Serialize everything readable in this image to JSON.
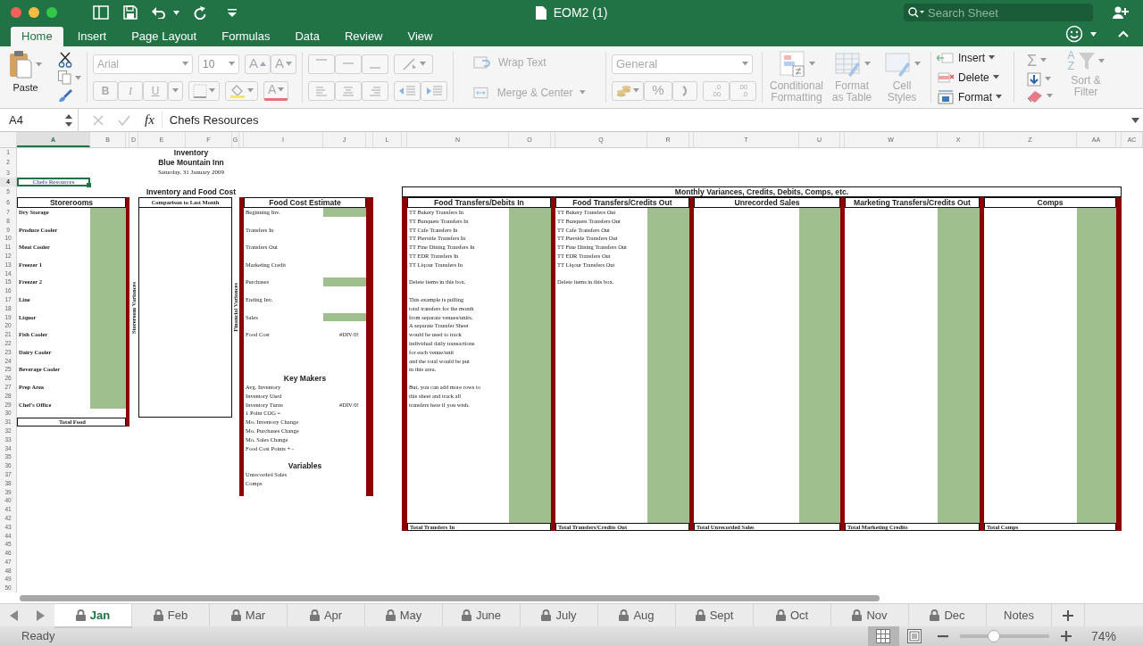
{
  "window": {
    "title": "EOM2 (1)"
  },
  "search": {
    "placeholder": "Search Sheet"
  },
  "ribbon_tabs": [
    {
      "label": "Home",
      "selected": true
    },
    {
      "label": "Insert",
      "selected": false
    },
    {
      "label": "Page Layout",
      "selected": false
    },
    {
      "label": "Formulas",
      "selected": false
    },
    {
      "label": "Data",
      "selected": false
    },
    {
      "label": "Review",
      "selected": false
    },
    {
      "label": "View",
      "selected": false
    }
  ],
  "ribbon": {
    "paste": {
      "label": "Paste",
      "disabled": false
    },
    "font": {
      "name": "Arial",
      "size": "10",
      "disabled": true
    },
    "font_buttons": [
      {
        "label": "A",
        "kind": "grow"
      },
      {
        "label": "A",
        "kind": "shrink"
      }
    ],
    "style_buttons": [
      {
        "label": "B",
        "kind": "bold"
      },
      {
        "label": "I",
        "kind": "italic"
      },
      {
        "label": "U",
        "kind": "underline"
      }
    ],
    "font_color": {
      "label": "A"
    },
    "wrap_text": {
      "label": "Wrap Text",
      "disabled": true
    },
    "merge": {
      "label": "Merge & Center",
      "disabled": true
    },
    "number_format": {
      "value": "General",
      "disabled": true
    },
    "percent": "%",
    "decimal_buttons": [
      {
        "top": ".0",
        "bottom": ".00"
      },
      {
        "top": ".00",
        "bottom": ".0"
      }
    ],
    "styles": [
      {
        "label": "Conditional Formatting",
        "kind": "conditional",
        "disabled": true
      },
      {
        "label": "Format as Table",
        "kind": "table",
        "disabled": true
      },
      {
        "label": "Cell Styles",
        "kind": "cell",
        "disabled": true
      }
    ],
    "cells": [
      {
        "label": "Insert",
        "kind": "insert",
        "disabled": false
      },
      {
        "label": "Delete",
        "kind": "delete",
        "disabled": false
      },
      {
        "label": "Format",
        "kind": "format",
        "disabled": false
      }
    ],
    "sum": "Σ",
    "sort": {
      "label": "Sort & Filter",
      "letters": [
        "A",
        "Z"
      ],
      "disabled": true
    }
  },
  "formula_bar": {
    "name_box": "A4",
    "function_label": "fx",
    "content": "Chefs Resources"
  },
  "sheet": {
    "columns": [
      {
        "label": "A",
        "selected": true
      },
      {
        "label": "B",
        "selected": false
      },
      {
        "selected": false
      },
      {
        "label": "D",
        "selected": false
      },
      {
        "label": "E",
        "selected": false
      },
      {
        "label": "F",
        "selected": false
      },
      {
        "label": "G",
        "selected": false
      },
      {
        "selected": false
      },
      {
        "label": "I",
        "selected": false
      },
      {
        "label": "J",
        "selected": false
      },
      {
        "selected": false
      },
      {
        "label": "L",
        "selected": false
      },
      {
        "selected": false
      },
      {
        "label": "N",
        "selected": false
      },
      {
        "label": "O",
        "selected": false
      },
      {
        "selected": false
      },
      {
        "label": "Q",
        "selected": false
      },
      {
        "label": "R",
        "selected": false
      },
      {
        "selected": false
      },
      {
        "label": "T",
        "selected": false
      },
      {
        "label": "U",
        "selected": false
      },
      {
        "selected": false
      },
      {
        "label": "W",
        "selected": false
      },
      {
        "label": "X",
        "selected": false
      },
      {
        "selected": false
      },
      {
        "label": "Z",
        "selected": false
      },
      {
        "label": "AA",
        "selected": false
      },
      {
        "selected": false
      },
      {
        "label": "AC",
        "selected": false
      }
    ],
    "rows": [
      {
        "label": "1",
        "selected": false
      },
      {
        "label": "2",
        "selected": false
      },
      {
        "label": "3",
        "selected": false
      },
      {
        "label": "4",
        "selected": true
      },
      {
        "label": "5",
        "selected": false
      },
      {
        "label": "6",
        "selected": false
      },
      {
        "label": "7",
        "selected": false
      },
      {
        "label": "8",
        "selected": false
      },
      {
        "label": "9",
        "selected": false
      },
      {
        "label": "10",
        "selected": false
      },
      {
        "label": "11",
        "selected": false
      },
      {
        "label": "12",
        "selected": false
      },
      {
        "label": "13",
        "selected": false
      },
      {
        "label": "14",
        "selected": false
      },
      {
        "label": "15",
        "selected": false
      },
      {
        "label": "16",
        "selected": false
      },
      {
        "label": "17",
        "selected": false
      },
      {
        "label": "18",
        "selected": false
      },
      {
        "label": "19",
        "selected": false
      },
      {
        "label": "20",
        "selected": false
      },
      {
        "label": "21",
        "selected": false
      },
      {
        "label": "22",
        "selected": false
      },
      {
        "label": "23",
        "selected": false
      },
      {
        "label": "24",
        "selected": false
      },
      {
        "label": "25",
        "selected": false
      },
      {
        "label": "26",
        "selected": false
      },
      {
        "label": "27",
        "selected": false
      },
      {
        "label": "28",
        "selected": false
      },
      {
        "label": "29",
        "selected": false
      },
      {
        "label": "30",
        "selected": false
      },
      {
        "label": "31",
        "selected": false
      },
      {
        "label": "32",
        "selected": false
      },
      {
        "label": "33",
        "selected": false
      },
      {
        "label": "34",
        "selected": false
      },
      {
        "label": "35",
        "selected": false
      },
      {
        "label": "36",
        "selected": false
      },
      {
        "label": "37",
        "selected": false
      },
      {
        "label": "38",
        "selected": false
      },
      {
        "label": "39",
        "selected": false
      },
      {
        "label": "40",
        "selected": false
      },
      {
        "label": "41",
        "selected": false
      },
      {
        "label": "42",
        "selected": false
      },
      {
        "label": "43",
        "selected": false
      },
      {
        "label": "44",
        "selected": false
      },
      {
        "label": "45",
        "selected": false
      },
      {
        "label": "46",
        "selected": false
      },
      {
        "label": "47",
        "selected": false
      },
      {
        "label": "48",
        "selected": false
      },
      {
        "label": "49",
        "selected": false
      },
      {
        "label": "50",
        "selected": false
      }
    ],
    "title": "Inventory",
    "subtitle": "Blue Mountain Inn",
    "date": "Saturday, 31 January 2009",
    "active_cell": {
      "text": "Chefs Resources"
    },
    "section_title": "Inventory and Food Cost",
    "storerooms": {
      "header": "Storerooms",
      "items": [
        "Dry Storage",
        "Produce Cooler",
        "Meat Cooler",
        "Freezer 1",
        "Freezer 2",
        "Line",
        "Liquor",
        "Fish Cooler",
        "Dairy Cooler",
        "Beverage Cooler",
        "Prep Area",
        "Chef's Office"
      ],
      "total": "Total Food",
      "side_label": "Storeroom Variances"
    },
    "comparison": {
      "header": "Comparison to Last Month",
      "side_label": "Financial Variances"
    },
    "food_cost": {
      "header": "Food Cost Estimate",
      "items": [
        {
          "label": "Beginning Inv.",
          "filled": true
        },
        {
          "label": "Transfers In",
          "filled": false
        },
        {
          "label": "Transfers Out",
          "filled": false
        },
        {
          "label": "Marketing Credit",
          "filled": false
        },
        {
          "label": "Purchases",
          "filled": true
        },
        {
          "label": "Ending Inv.",
          "filled": false
        },
        {
          "label": "Sales",
          "filled": true
        },
        {
          "label": "Food Cost",
          "value": "#DIV/0!",
          "filled": false
        }
      ],
      "key_makers": {
        "title": "Key Makers",
        "items": [
          {
            "label": "Avg. Inventory"
          },
          {
            "label": "Inventory Used"
          },
          {
            "label": "Inventory Turns",
            "value": "#DIV/0!"
          },
          {
            "label": "1 Point COG ="
          },
          {
            "label": "Mo. Inventory Change"
          },
          {
            "label": "Mo. Purchases Change"
          },
          {
            "label": "Mo. Sales Change"
          },
          {
            "label": "Food Cost Points + -"
          }
        ]
      },
      "variables": {
        "title": "Variables",
        "items": [
          "Unrecorded Sales",
          "Comps"
        ]
      }
    },
    "monthly": {
      "title": "Monthly Variances, Credits, Debits, Comps, etc.",
      "panels": [
        {
          "header": "Food Transfers/Debits In",
          "paragraphs": [
            [
              "TT Bakery Transfers In",
              "TT Banquets Transfers In",
              "TT Cafe Transfers In",
              "TT Pierside Transfers In",
              "TT Fine Dining Transfers In",
              "TT EDR Transfers In",
              "TT Liqour Transfers In"
            ],
            [
              "Delete items in this box."
            ],
            [
              "This example is  pulling",
              "total transfers for the month",
              "from separate venues/units.",
              "A separate Transfer Sheet",
              "would be used to track",
              "individual daily transactions",
              "for each venue/unit",
              "and the total would be put",
              "in this area."
            ],
            [
              "But, you can add more rows to",
              "this sheet and track all",
              "transfers here if you wish."
            ]
          ],
          "total": "Total Transfers In"
        },
        {
          "header": "Food Transfers/Credits Out",
          "paragraphs": [
            [
              "TT Bakery Transfers Out",
              "TT Banquets Transfers Out",
              "TT Cafe Transfers Out",
              "TT Pierside Transfers Out",
              "TT Fine Dining Transfers Out",
              "TT EDR Transfers Out",
              "TT Liqour Transfers Out"
            ],
            [
              "Delete items in this box."
            ]
          ],
          "total": "Total Transfers/Credits Out"
        },
        {
          "header": "Unrecorded Sales",
          "total": "Total Unrecorded Sales"
        },
        {
          "header": "Marketing Transfers/Credits Out",
          "total": "Total Marketing Credits"
        },
        {
          "header": "Comps",
          "total": "Total Comps"
        }
      ]
    }
  },
  "sheet_tabs": [
    {
      "label": "Jan",
      "selected": true,
      "locked": true
    },
    {
      "label": "Feb",
      "selected": false,
      "locked": true
    },
    {
      "label": "Mar",
      "selected": false,
      "locked": true
    },
    {
      "label": "Apr",
      "selected": false,
      "locked": true
    },
    {
      "label": "May",
      "selected": false,
      "locked": true
    },
    {
      "label": "June",
      "selected": false,
      "locked": true
    },
    {
      "label": "July",
      "selected": false,
      "locked": true
    },
    {
      "label": "Aug",
      "selected": false,
      "locked": true
    },
    {
      "label": "Sept",
      "selected": false,
      "locked": true
    },
    {
      "label": "Oct",
      "selected": false,
      "locked": true
    },
    {
      "label": "Nov",
      "selected": false,
      "locked": true
    },
    {
      "label": "Dec",
      "selected": false,
      "locked": true
    },
    {
      "label": "Notes",
      "selected": false,
      "locked": false
    }
  ],
  "status_bar": {
    "status": "Ready",
    "views": [
      {
        "kind": "normal",
        "selected": true
      },
      {
        "kind": "page-layout",
        "selected": false
      }
    ],
    "zoom": {
      "level": 0.38,
      "reading": "74%"
    }
  }
}
